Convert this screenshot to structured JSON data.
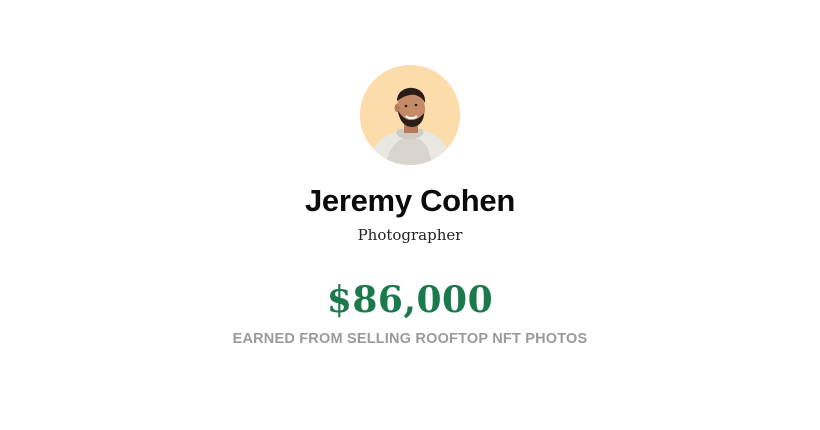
{
  "profile": {
    "name": "Jeremy Cohen",
    "role": "Photographer",
    "avatar_icon": "person-photo-avatar",
    "avatar_background": "#fddcac"
  },
  "stats": {
    "amount": "$86,000",
    "caption": "EARNED FROM SELLING ROOFTOP NFT PHOTOS",
    "amount_color": "#1a7a4c"
  }
}
